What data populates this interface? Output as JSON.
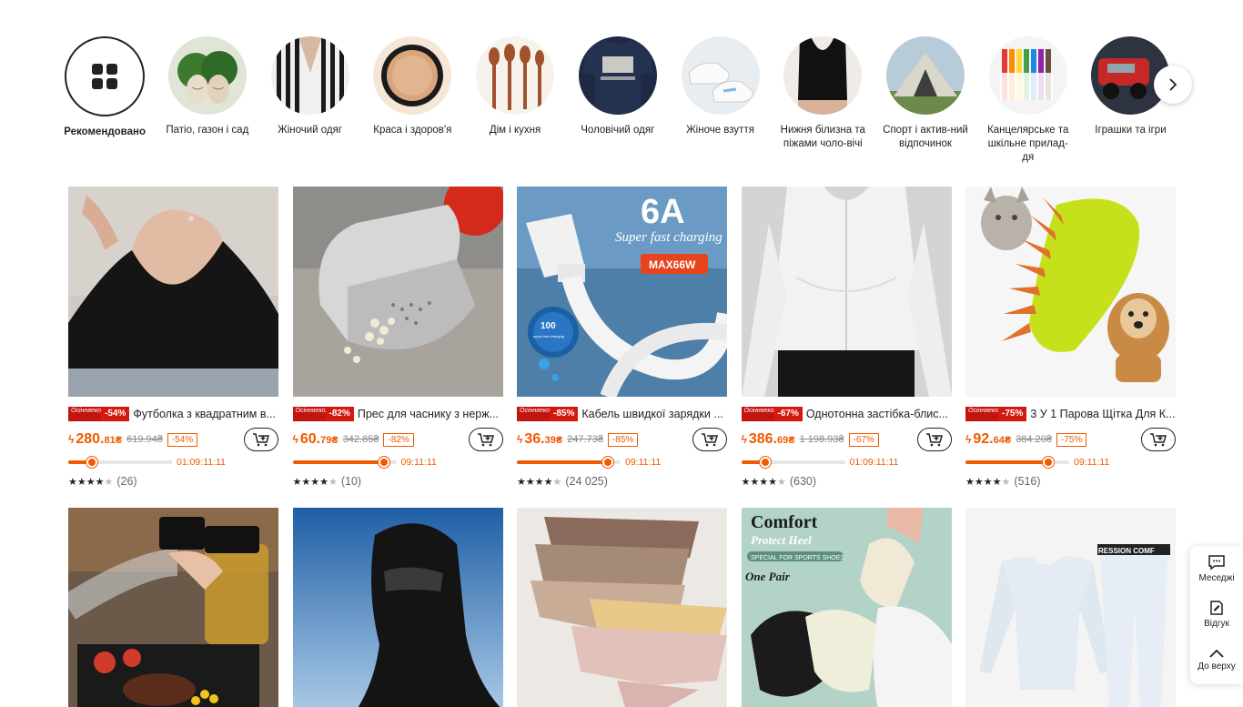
{
  "categories": [
    {
      "label": "Рекомендовано",
      "selected": true
    },
    {
      "label": "Патіо, газон і сад"
    },
    {
      "label": "Жіночий одяг"
    },
    {
      "label": "Краса і здоров'я"
    },
    {
      "label": "Дім і кухня"
    },
    {
      "label": "Чоловічий одяг"
    },
    {
      "label": "Жіноче взуття"
    },
    {
      "label": "Нижня білизна та піжами чоло-вічі"
    },
    {
      "label": "Спорт і актив-ний відпочинок"
    },
    {
      "label": "Канцелярське та шкільне прилад-дя"
    },
    {
      "label": "Іграшки та ігри"
    }
  ],
  "products": [
    {
      "tag_top": "Осінняекономія",
      "tag_discount": "-54%",
      "title": "Футболка з квадратним в...",
      "price_main": "280.",
      "price_cents": "81₴",
      "old_price": "619.94₴",
      "discount": "-54%",
      "progress": 0.23,
      "timer": "01:09:11:11",
      "rating": 4.5,
      "reviews": "(26)"
    },
    {
      "tag_top": "Осінняекономія",
      "tag_discount": "-82%",
      "title": "Прес для часнику з нерж...",
      "price_main": "60.",
      "price_cents": "79₴",
      "old_price": "342.85₴",
      "discount": "-82%",
      "progress": 0.88,
      "timer": "09:11:11",
      "rating": 4.5,
      "reviews": "(10)"
    },
    {
      "tag_top": "Осінняекономія",
      "tag_discount": "-85%",
      "title": "Кабель швидкої зарядки ...",
      "price_main": "36.",
      "price_cents": "39₴",
      "old_price": "247.73₴",
      "discount": "-85%",
      "progress": 0.88,
      "timer": "09:11:11",
      "rating": 4.5,
      "reviews": "(24 025)"
    },
    {
      "tag_top": "Осінняекономія",
      "tag_discount": "-67%",
      "title": "Однотонна застібка-блис...",
      "price_main": "386.",
      "price_cents": "69₴",
      "old_price": "1 198.93₴",
      "discount": "-67%",
      "progress": 0.23,
      "timer": "01:09:11:11",
      "rating": 4.5,
      "reviews": "(630)"
    },
    {
      "tag_top": "Осінняекономія",
      "tag_discount": "-75%",
      "title": "3 У 1 Парова Щітка Для К...",
      "price_main": "92.",
      "price_cents": "64₴",
      "old_price": "384.20₴",
      "discount": "-75%",
      "progress": 0.8,
      "timer": "09:11:11",
      "rating": 4.5,
      "reviews": "(516)"
    }
  ],
  "row2_images": [
    {
      "name": "oil-sprayer"
    },
    {
      "name": "balaclava"
    },
    {
      "name": "panties-set"
    },
    {
      "name": "heel-protectors",
      "text1": "Comfort",
      "text2": "Protect Heel",
      "text3": "SPECIAL FOR SPORTS SHOES",
      "text4": "One Pair"
    },
    {
      "name": "thermal-underwear",
      "text1": "RESSION COMF"
    }
  ],
  "cable_image": {
    "big": "6A",
    "sub": "Super fast charging",
    "badge": "MAX66W",
    "round1": "100",
    "round2": "super fast charging"
  },
  "side_panel": {
    "messages": "Меседжі",
    "feedback": "Відгук",
    "to_top": "До верху"
  },
  "colors": {
    "accent": "#f05a00",
    "tag_red": "#d41a10"
  }
}
